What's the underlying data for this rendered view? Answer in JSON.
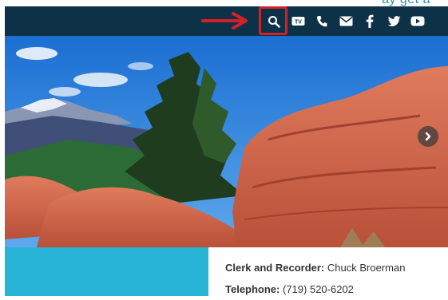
{
  "header": {
    "tagline_fragment": "ay get a",
    "nav_icons": [
      {
        "name": "search-icon"
      },
      {
        "name": "tv-icon"
      },
      {
        "name": "phone-icon"
      },
      {
        "name": "mail-icon"
      },
      {
        "name": "facebook-icon"
      },
      {
        "name": "twitter-icon"
      },
      {
        "name": "youtube-icon"
      }
    ]
  },
  "annotation": {
    "arrow_color": "#d42128",
    "highlight_color": "#d42128"
  },
  "colors": {
    "navbar": "#0d3147",
    "panel": "#27b4d6"
  },
  "hero": {
    "next_icon": "chevron-right-icon"
  },
  "contact": {
    "clerk_label": "Clerk and Recorder:",
    "clerk_value": "Chuck Broerman",
    "phone_label": "Telephone:",
    "phone_value": "(719) 520-6202"
  }
}
